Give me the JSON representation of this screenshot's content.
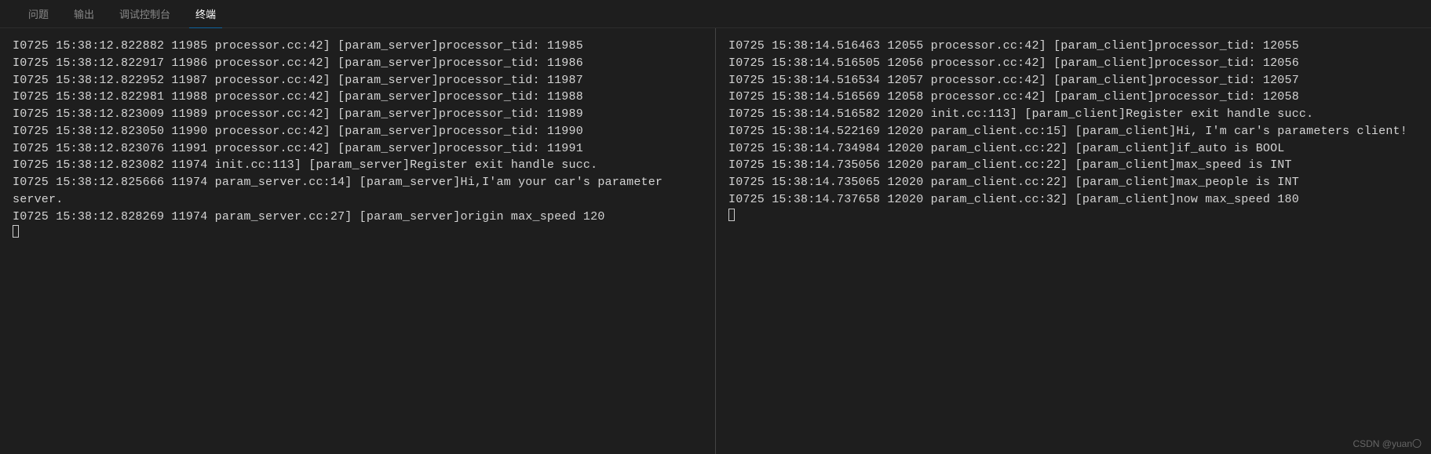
{
  "header": {
    "tabs": [
      {
        "label": "问题",
        "active": false
      },
      {
        "label": "输出",
        "active": false
      },
      {
        "label": "调试控制台",
        "active": false
      },
      {
        "label": "终端",
        "active": true
      }
    ]
  },
  "terminal": {
    "left_pane": {
      "lines": [
        "I0725 15:38:12.822882 11985 processor.cc:42] [param_server]processor_tid: 11985",
        "I0725 15:38:12.822917 11986 processor.cc:42] [param_server]processor_tid: 11986",
        "I0725 15:38:12.822952 11987 processor.cc:42] [param_server]processor_tid: 11987",
        "I0725 15:38:12.822981 11988 processor.cc:42] [param_server]processor_tid: 11988",
        "I0725 15:38:12.823009 11989 processor.cc:42] [param_server]processor_tid: 11989",
        "I0725 15:38:12.823050 11990 processor.cc:42] [param_server]processor_tid: 11990",
        "I0725 15:38:12.823076 11991 processor.cc:42] [param_server]processor_tid: 11991",
        "I0725 15:38:12.823082 11974 init.cc:113] [param_server]Register exit handle succ.",
        "I0725 15:38:12.825666 11974 param_server.cc:14] [param_server]Hi,I'am your car's parameter server.",
        "I0725 15:38:12.828269 11974 param_server.cc:27] [param_server]origin max_speed 120"
      ]
    },
    "right_pane": {
      "lines": [
        "I0725 15:38:14.516463 12055 processor.cc:42] [param_client]processor_tid: 12055",
        "I0725 15:38:14.516505 12056 processor.cc:42] [param_client]processor_tid: 12056",
        "I0725 15:38:14.516534 12057 processor.cc:42] [param_client]processor_tid: 12057",
        "I0725 15:38:14.516569 12058 processor.cc:42] [param_client]processor_tid: 12058",
        "I0725 15:38:14.516582 12020 init.cc:113] [param_client]Register exit handle succ.",
        "I0725 15:38:14.522169 12020 param_client.cc:15] [param_client]Hi, I'm car's parameters client!",
        "I0725 15:38:14.734984 12020 param_client.cc:22] [param_client]if_auto is BOOL",
        "I0725 15:38:14.735056 12020 param_client.cc:22] [param_client]max_speed is INT",
        "I0725 15:38:14.735065 12020 param_client.cc:22] [param_client]max_people is INT",
        "I0725 15:38:14.737658 12020 param_client.cc:32] [param_client]now max_speed 180"
      ]
    }
  },
  "watermark": "CSDN @yuan〇"
}
